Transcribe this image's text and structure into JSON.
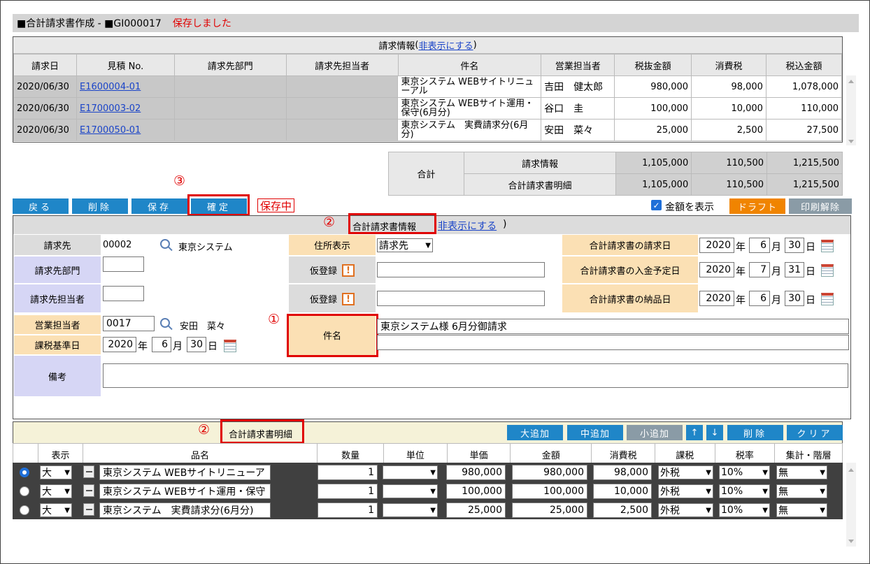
{
  "title": {
    "text": "■合計請求書作成 - ■GI000017",
    "saved": "保存しました"
  },
  "invoice_info": {
    "caption": "請求情報",
    "hide_link": "非表示にする",
    "paren_open": "(",
    "paren_close": ")",
    "headers": [
      "請求日",
      "見積 No.",
      "請求先部門",
      "請求先担当者",
      "件名",
      "営業担当者",
      "税抜金額",
      "消費税",
      "税込金額"
    ],
    "rows": [
      [
        "2020/06/30",
        "E1600004-01",
        "",
        "",
        "東京システム WEBサイトリニューアル",
        "吉田　健太郎",
        "980,000",
        "98,000",
        "1,078,000"
      ],
      [
        "2020/06/30",
        "E1700003-02",
        "",
        "",
        "東京システム WEBサイト運用・保守(6月分)",
        "谷口　圭",
        "100,000",
        "10,000",
        "110,000"
      ],
      [
        "2020/06/30",
        "E1700050-01",
        "",
        "",
        "東京システム　実費請求分(6月分)",
        "安田　菜々",
        "25,000",
        "2,500",
        "27,500"
      ]
    ]
  },
  "totals": {
    "label": "合計",
    "rows": [
      [
        "請求情報",
        "1,105,000",
        "110,500",
        "1,215,500"
      ],
      [
        "合計請求書明細",
        "1,105,000",
        "110,500",
        "1,215,500"
      ]
    ]
  },
  "toolbar": {
    "back": "戻る",
    "delete": "削除",
    "save": "保存",
    "confirm": "確定",
    "saving": "保存中",
    "show_amount": "金額を表示",
    "draft": "ドラフト",
    "print_release": "印刷解除"
  },
  "annotations": {
    "n1": "①",
    "n2": "②",
    "n3": "③"
  },
  "form": {
    "caption": "合計請求書情報",
    "hide_link": "非表示にする",
    "paren_close": ")",
    "billing_to_label": "請求先",
    "billing_to_code": "00002",
    "billing_to_name": "東京システム",
    "dept_label": "請求先部門",
    "person_label": "請求先担当者",
    "sales_label": "営業担当者",
    "sales_code": "0017",
    "sales_name": "安田　菜々",
    "tax_date_label": "課税基準日",
    "tax_year": "2020",
    "tax_month": "6",
    "tax_day": "30",
    "note_label": "備考",
    "address_label": "住所表示",
    "address_value": "請求先",
    "temp1_label": "仮登録",
    "temp2_label": "仮登録",
    "subject_label": "件名",
    "subject_value": "東京システム様 6月分御請求",
    "subject_value2": "",
    "bill_date_label": "合計請求書の請求日",
    "bill_date": [
      "2020",
      "6",
      "30"
    ],
    "pay_date_label": "合計請求書の入金予定日",
    "pay_date": [
      "2020",
      "7",
      "31"
    ],
    "deliv_date_label": "合計請求書の納品日",
    "deliv_date": [
      "2020",
      "6",
      "30"
    ],
    "unit_year": "年",
    "unit_month": "月",
    "unit_day": "日"
  },
  "details": {
    "caption": "合計請求書明細",
    "buttons": {
      "add_large": "大追加",
      "add_medium": "中追加",
      "add_small": "小追加",
      "up": "↑",
      "down": "↓",
      "delete": "削除",
      "clear": "クリア"
    },
    "headers": [
      "表示",
      "品名",
      "数量",
      "単位",
      "単価",
      "金額",
      "消費税",
      "課税",
      "税率",
      "集計・階層"
    ],
    "rows": [
      {
        "size": "大",
        "name": "東京システム WEBサイトリニューア",
        "qty": "1",
        "unit": "",
        "price": "980,000",
        "amount": "980,000",
        "tax": "98,000",
        "taxtype": "外税",
        "rate": "10%",
        "agg": "無"
      },
      {
        "size": "大",
        "name": "東京システム WEBサイト運用・保守",
        "qty": "1",
        "unit": "",
        "price": "100,000",
        "amount": "100,000",
        "tax": "10,000",
        "taxtype": "外税",
        "rate": "10%",
        "agg": "無"
      },
      {
        "size": "大",
        "name": "東京システム　実費請求分(6月分)",
        "qty": "1",
        "unit": "",
        "price": "25,000",
        "amount": "25,000",
        "tax": "2,500",
        "taxtype": "外税",
        "rate": "10%",
        "agg": "無"
      }
    ]
  }
}
